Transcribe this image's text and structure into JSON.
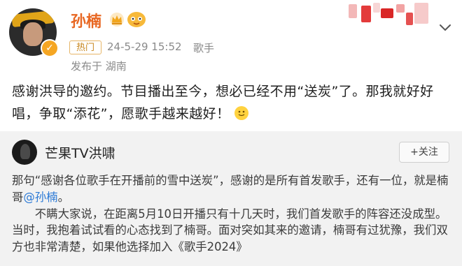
{
  "post": {
    "author": "孙楠",
    "hot_tag": "热门",
    "time": "24-5-29 15:52",
    "source": "歌手",
    "location": "发布于 湖南",
    "text": "感谢洪导的邀约。节目播出至今，想必已经不用“送炭”了。那我就好好唱，争取“添花”，愿歌手越来越好！"
  },
  "repost": {
    "author": "芒果TV洪啸",
    "follow_label": "+关注",
    "para1_before": "那句“感谢各位歌手在开播前的雪中送炭”，感谢的是所有首发歌手，还有一位，就是楠哥",
    "mention": "@孙楠",
    "para1_after": "。",
    "para2": "不瞒大家说，在距离5月10日开播只有十几天时，我们首发歌手的阵容还没成型。当时，我抱着试试看的心态找到了楠哥。面对突如其来的邀请，楠哥有过犹豫，我们双方也非常清楚，如果他选择加入《歌手2024》"
  },
  "icons": {
    "crown": "crown-icon",
    "vip": "vip-icon",
    "verify": "verified-badge-icon",
    "menu": "chevron-down-icon",
    "emoji": "smile-emoji-icon"
  },
  "colors": {
    "username": "#e86722",
    "hot_tag_border": "#e6b567",
    "mention": "#2c7ad6",
    "repost_bg": "#f2f2f2"
  }
}
